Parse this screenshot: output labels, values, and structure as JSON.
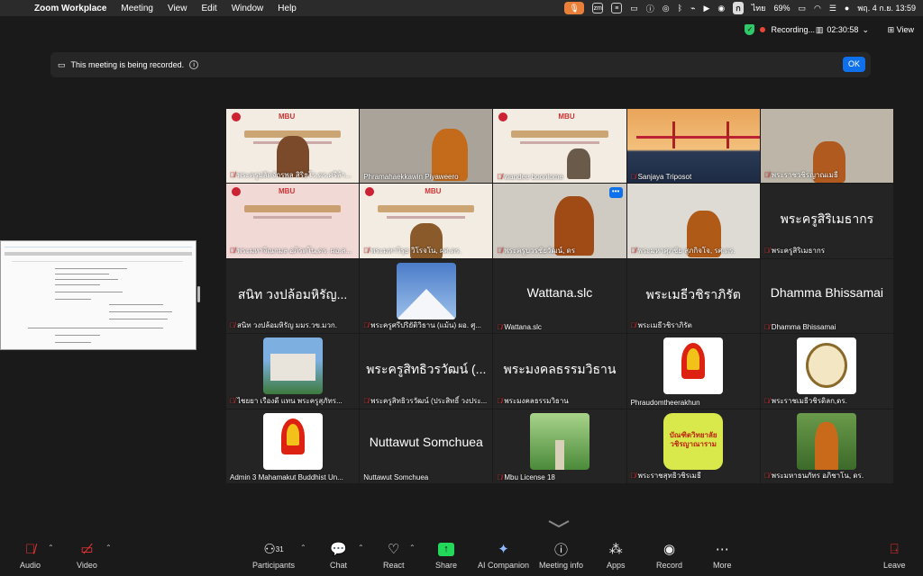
{
  "menubar": {
    "app_name": "Zoom Workplace",
    "items": [
      "Meeting",
      "View",
      "Edit",
      "Window",
      "Help"
    ],
    "battery": "69%",
    "input_lang": "ก",
    "lang_label": "ไทย",
    "datetime": "พฤ. 4 ก.ย. 13:59"
  },
  "topbar": {
    "recording": "Recording...",
    "elapsed": "02:30:58",
    "view_label": "View"
  },
  "banner": {
    "text": "This meeting is being recorded.",
    "ok_label": "OK"
  },
  "tiles": [
    {
      "name": "พระครูปลัดจักรพล สิริธโร,ดร.ศรีล้า...",
      "kind": "slide",
      "slide_title": "MBU"
    },
    {
      "name": "Phramahaekkawin Piyaweero",
      "kind": "cam"
    },
    {
      "name": "wandee boonlome",
      "kind": "slide",
      "slide_title": "MBU"
    },
    {
      "name": "Sanjaya Triposot",
      "kind": "sunset"
    },
    {
      "name": "พระราชวชิรญาณเมธี",
      "kind": "cam"
    },
    {
      "name": "พระมหาจิณกมล อภิรตโน,ดร. ผอ.ส...",
      "kind": "slide",
      "slide_title": "MBU"
    },
    {
      "name": "พระมหาวิรุธ วิโรจโน, ผศ.ดร.",
      "kind": "slide",
      "slide_title": "MBU"
    },
    {
      "name": "พระครูบวรชัยวัฒน์, ดร",
      "kind": "cam"
    },
    {
      "name": "พระมหาศุภชัย สุภกิจโจ, รศ.ดร.",
      "kind": "cam"
    },
    {
      "name": "พระครูสิริเมธากร",
      "kind": "text",
      "big": "พระครูสิริเมธากร"
    },
    {
      "name": "สนิท วงปล้อมหิรัญ มมร.วข.มวก.",
      "kind": "text",
      "big": "สนิท วงปล้อมหิรัญ..."
    },
    {
      "name": "พระครูศรีปริยัติวิธาน (แม้น) ผอ. ศู...",
      "kind": "mountain"
    },
    {
      "name": "Wattana.slc",
      "kind": "text",
      "big": "Wattana.slc"
    },
    {
      "name": "พระเมธีวชิราภิรัต",
      "kind": "text",
      "big": "พระเมธีวชิราภิรัต"
    },
    {
      "name": "Dhamma Bhissamai",
      "kind": "text",
      "big": "Dhamma Bhissamai"
    },
    {
      "name": "ไชยยา เรืองดี แทน พระครูสุภัทร...",
      "kind": "building"
    },
    {
      "name": "พระครูสิทธิวรวัฒน์ (ประสิทธิ์ วงประ...",
      "kind": "text",
      "big": "พระครูสิทธิวรวัฒน์ (..."
    },
    {
      "name": "พระมงคลธรรมวิธาน",
      "kind": "text",
      "big": "พระมงคลธรรมวิธาน"
    },
    {
      "name": "Phraudomtheerakhun",
      "kind": "emblem"
    },
    {
      "name": "พระราชเมธีวชิรดิลก,ดร.",
      "kind": "seal"
    },
    {
      "name": "Admin 3 Mahamakut Buddhist Un...",
      "kind": "emblem"
    },
    {
      "name": "Nuttawut Somchuea",
      "kind": "text",
      "big": "Nuttawut Somchuea"
    },
    {
      "name": "Mbu License 18",
      "kind": "trees"
    },
    {
      "name": "พระราชสุทธิวชิรเมธี",
      "kind": "sign",
      "sign_text": "บัณฑิตวิทยาลัย วชิรญาณาราม"
    },
    {
      "name": "พระมหาธนภัทร อภิชาโน, ดร.",
      "kind": "outdoor"
    }
  ],
  "toolbar": {
    "audio": "Audio",
    "video": "Video",
    "participants": "Participants",
    "participant_count": "31",
    "chat": "Chat",
    "react": "React",
    "share": "Share",
    "ai": "AI Companion",
    "meeting_info": "Meeting info",
    "apps": "Apps",
    "record": "Record",
    "more": "More",
    "leave": "Leave"
  },
  "colors": {
    "accent": "#0e71eb",
    "share_green": "#23d959",
    "muted_red": "#e33"
  }
}
